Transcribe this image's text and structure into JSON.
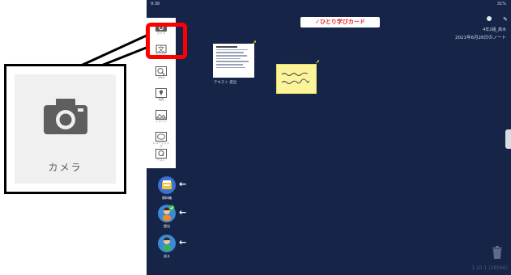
{
  "status": {
    "time": "9:38",
    "right": "31%"
  },
  "header": {
    "title": "✓ひとり学びカード",
    "menu_icon": "ellipsis-icon"
  },
  "user": {
    "name": "4年2組_高木",
    "note_date": "2021年6月26日のノート"
  },
  "toolbar": {
    "tools": [
      {
        "name": "camera",
        "label": "カメラ"
      },
      {
        "name": "text",
        "label": "テキスト"
      },
      {
        "name": "web",
        "label": "Web"
      },
      {
        "name": "map",
        "label": "地図"
      },
      {
        "name": "image",
        "label": "イメージ"
      },
      {
        "name": "record",
        "label": "レコーディング"
      },
      {
        "name": "quiz",
        "label": "テスト"
      }
    ]
  },
  "actions": {
    "materials": "資料箱",
    "submit": "提出",
    "send": "送る"
  },
  "cards": {
    "doc_caption": "テキスト 提出"
  },
  "callout": {
    "label": "カメラ"
  },
  "version": "1.10.1 (28566)",
  "colors": {
    "screen_bg": "#162448",
    "highlight": "#ff0000",
    "sticky": "#fbf49a"
  }
}
